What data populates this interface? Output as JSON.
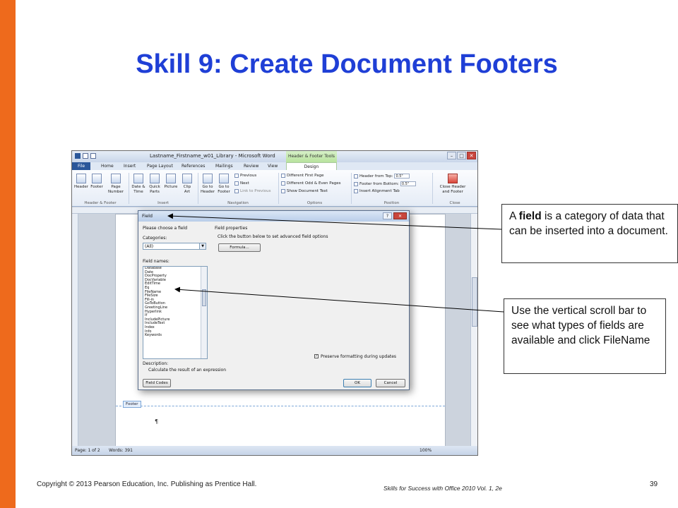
{
  "slide": {
    "title": "Skill 9: Create Document Footers",
    "copyright": "Copyright © 2013 Pearson Education, Inc. Publishing as Prentice Hall.",
    "book_title": "Skills for Success with Office 2010 Vol. 1, 2e",
    "slide_number": "39",
    "accent_color": "#ee6a1c",
    "title_color": "#1f3fd6"
  },
  "callouts": {
    "field": {
      "pre": "A ",
      "bold": "field",
      "post": " is a category of data that can be inserted into a document."
    },
    "scroll": {
      "text": "Use the vertical scroll bar to see what types of fields are available and click FileName"
    }
  },
  "word": {
    "window_title": "Lastname_Firstname_w01_Library - Microsoft Word",
    "context_tab": "Header & Footer Tools",
    "window_buttons": [
      "–",
      "□",
      "✕"
    ],
    "tabs": [
      "File",
      "Home",
      "Insert",
      "Page Layout",
      "References",
      "Mailings",
      "Review",
      "View",
      "Design"
    ],
    "ribbon": {
      "header": "Header",
      "footer": "Footer",
      "page_number": "Page Number",
      "date_time": "Date & Time",
      "quick_parts": "Quick Parts",
      "picture": "Picture",
      "clip_art": "Clip Art",
      "go_to_header": "Go to Header",
      "go_to_footer": "Go to Footer",
      "previous": "Previous",
      "next": "Next",
      "link_to_previous": "Link to Previous",
      "different_first_page": "Different First Page",
      "different_odd_even": "Different Odd & Even Pages",
      "show_document_text": "Show Document Text",
      "header_from_top": "Header from Top:",
      "header_from_top_value": "0.5\"",
      "footer_from_bottom": "Footer from Bottom:",
      "footer_from_bottom_value": "0.5\"",
      "insert_alignment_tab": "Insert Alignment Tab",
      "close_header_footer": "Close Header and Footer",
      "groups": [
        "Header & Footer",
        "Insert",
        "Navigation",
        "Options",
        "Position",
        "Close"
      ]
    },
    "footer_tab_label": "Footer",
    "paragraph_mark": "¶",
    "status": {
      "page": "Page: 1 of 2",
      "words": "Words: 391",
      "zoom": "100%"
    }
  },
  "field_dialog": {
    "title": "Field",
    "help": "?",
    "close": "✕",
    "please_choose": "Please choose a field",
    "categories_label": "Categories:",
    "categories_value": "(All)",
    "field_names_label": "Field names:",
    "field_names": [
      "Database",
      "Date",
      "DocProperty",
      "DocVariable",
      "EditTime",
      "Eq",
      "FileName",
      "FileSize",
      "Fill-in",
      "GoToButton",
      "GreetingLine",
      "Hyperlink",
      "If",
      "IncludePicture",
      "IncludeText",
      "Index",
      "Info",
      "Keywords"
    ],
    "field_properties": "Field properties",
    "click_button_text": "Click the button below to set advanced field options",
    "formula_button": "Formula...",
    "preserve_formatting": "Preserve formatting during updates",
    "description_label": "Description:",
    "description_text": "Calculate the result of an expression",
    "field_codes_button": "Field Codes",
    "ok_button": "OK",
    "cancel_button": "Cancel"
  }
}
